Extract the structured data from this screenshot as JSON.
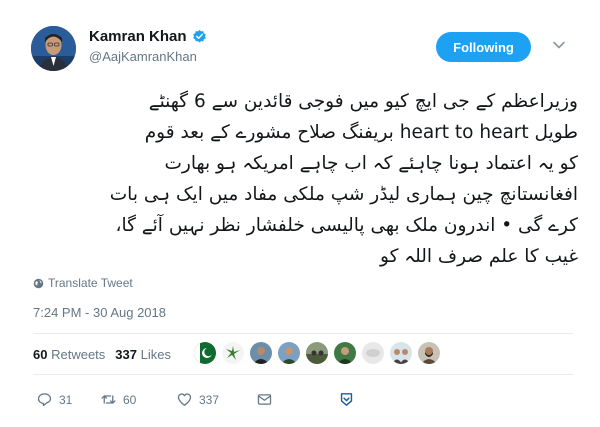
{
  "author": {
    "name": "Kamran Khan",
    "handle": "@AajKamranKhan"
  },
  "follow_button": {
    "label": "Following"
  },
  "tweet": {
    "lines": [
      "وزیراعظم کے جی ایچ کیو میں فوجی قائدین سے 6 گھنٹے",
      "طویل heart to heart بریفنگ صلاح مشورے کے بعد قوم",
      "کو یہ اعتماد ہونا چاہئے کہ اب چاہے امریکہ  ہو بھارت",
      "افغانستانچ چین ہماری لیڈر شپ ملکی مفاد میں ایک ہی بات",
      "کرے گی • اندرون ملک بھی پالیسی خلفشار نظر نہیں آئے گا،",
      "غیب کا علم صرف اللہ کو"
    ]
  },
  "translate_label": "Translate Tweet",
  "timestamp": "7:24 PM - 30 Aug 2018",
  "stats": {
    "retweets_count": "60",
    "retweets_label": "Retweets",
    "likes_count": "337",
    "likes_label": "Likes"
  },
  "likers_count_shown": 9,
  "actions": {
    "reply_count": "31",
    "retweet_count": "60",
    "like_count": "337"
  },
  "colors": {
    "accent": "#1da1f2",
    "secondary_text": "#657786",
    "primary_text": "#14171a",
    "divider": "#e6ecf0"
  },
  "icons": [
    "verified-badge-icon",
    "chevron-down-icon",
    "globe-icon",
    "reply-icon",
    "retweet-icon",
    "heart-icon",
    "message-icon",
    "share-icon"
  ]
}
